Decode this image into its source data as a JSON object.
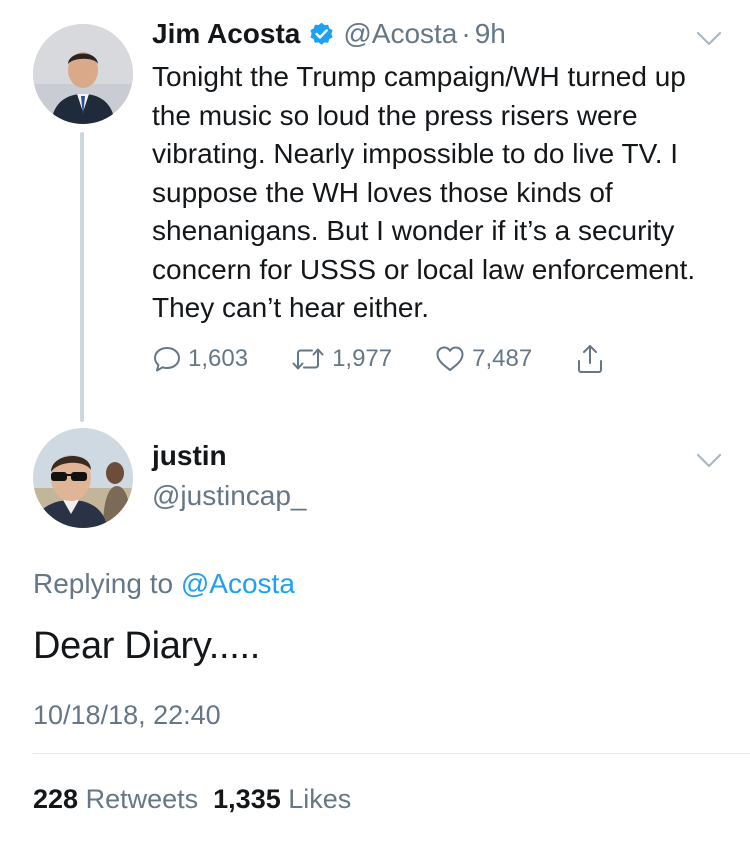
{
  "original_tweet": {
    "display_name": "Jim Acosta",
    "handle": "@Acosta",
    "separator": "·",
    "time": "9h",
    "verified": true,
    "text": "Tonight the Trump campaign/WH turned up the music so loud the press risers were vibrating. Nearly impossible to do live TV. I suppose the WH loves those kinds of shenanigans. But I wonder if it’s a security concern for USSS or local law enforcement. They can’t hear either.",
    "actions": {
      "replies": "1,603",
      "retweets": "1,977",
      "likes": "7,487"
    }
  },
  "reply_tweet": {
    "display_name": "justin",
    "handle": "@justincap_",
    "replying_prefix": "Replying to",
    "replying_to": "@Acosta",
    "text": "Dear Diary.....",
    "timestamp": "10/18/18, 22:40",
    "retweet_count": "228",
    "retweet_label": "Retweets",
    "like_count": "1,335",
    "like_label": "Likes"
  },
  "colors": {
    "primary_text": "#14171a",
    "secondary_text": "#657786",
    "link": "#1da1f2",
    "verified_badge": "#1da1f2",
    "divider": "#e1e8ed",
    "thread_line": "#ccd6dd"
  },
  "icons": {
    "reply": "reply-icon",
    "retweet": "retweet-icon",
    "like": "heart-icon",
    "share": "share-icon",
    "verified": "verified-badge-icon",
    "menu": "chevron-down-icon"
  }
}
